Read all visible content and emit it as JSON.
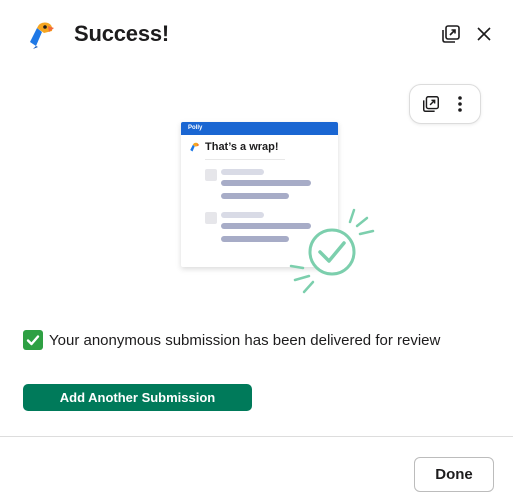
{
  "header": {
    "title": "Success!"
  },
  "illustration": {
    "app_name": "Polly",
    "card_title": "That’s a wrap!"
  },
  "message": {
    "text": "Your anonymous submission has been delivered for review"
  },
  "actions": {
    "add_another_label": "Add Another Submission",
    "done_label": "Done"
  },
  "colors": {
    "primary": "#007a5a",
    "card_header": "#1a66d2",
    "celebration": "#7ccfad",
    "placeholder": "#a7acc7",
    "checkmark": "#2ea043"
  },
  "icons": {
    "logo": "polly-parrot-logo",
    "popout": "popout-icon",
    "close": "close-icon",
    "more": "more-vertical-icon",
    "check": "check-mark-button-emoji"
  }
}
